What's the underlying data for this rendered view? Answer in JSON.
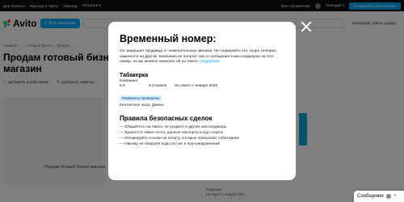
{
  "topbar": {
    "links": [
      "Для бизнеса",
      "Карьера в Авито",
      "Помощь",
      "Каталоги ▾"
    ],
    "messages_link": "Мои объявления",
    "user": "Геннадий ▾",
    "post_ad": "Разместить объявление"
  },
  "header": {
    "logo": "Avito",
    "catalog_button": "Все категории",
    "location": "Краснодар, район, радиус"
  },
  "page": {
    "breadcrumbs": "Главная › ... › Готовый бизнес › Продаю ... ›",
    "title": "Продам готовый бизнес магазин",
    "actions": [
      "Добавить в избранное",
      "Добавить заметку"
    ],
    "photo_alt": "Продам готовый бизнес магазин",
    "company_line1": "Компания",
    "company_line2": "На Авито с января 2020",
    "messages_widget": "Сообщения"
  },
  "modal": {
    "title": "Временный номер:",
    "description": "Он защищает продавца от нежелательных звонков. Не сохраняйте его: скоро телефон заменится на другой. Компания не получит смс и сообщения в мессенджерах на этот номер, но вы можете написать ей на Авито.",
    "link": "Подробнее",
    "seller_name": "Табакерка",
    "seller_type": "Компания",
    "rating": "5.0",
    "reviews": "8 отзывов",
    "since": "На Авито с января 2020",
    "verified_badge": "Реквизиты проверены",
    "contact": "Контактное лицо: Диана",
    "rules_title": "Правила безопасных сделок",
    "rules": [
      "— Общайтесь на Авито, не уходите в другие мессенджеры",
      "— Храните в тайне почту, данные паспорта и код с карты",
      "— Игнорируйте ссылки на оплату, которые присылает собеседник",
      "— Никому не говорите коды из смс и пуш-уведомлений"
    ]
  },
  "colors": {
    "accent": "#00aaff",
    "badge_bg": "#d4ecff",
    "link": "#0099f7",
    "overlay": "rgba(0,0,0,0.5)"
  }
}
